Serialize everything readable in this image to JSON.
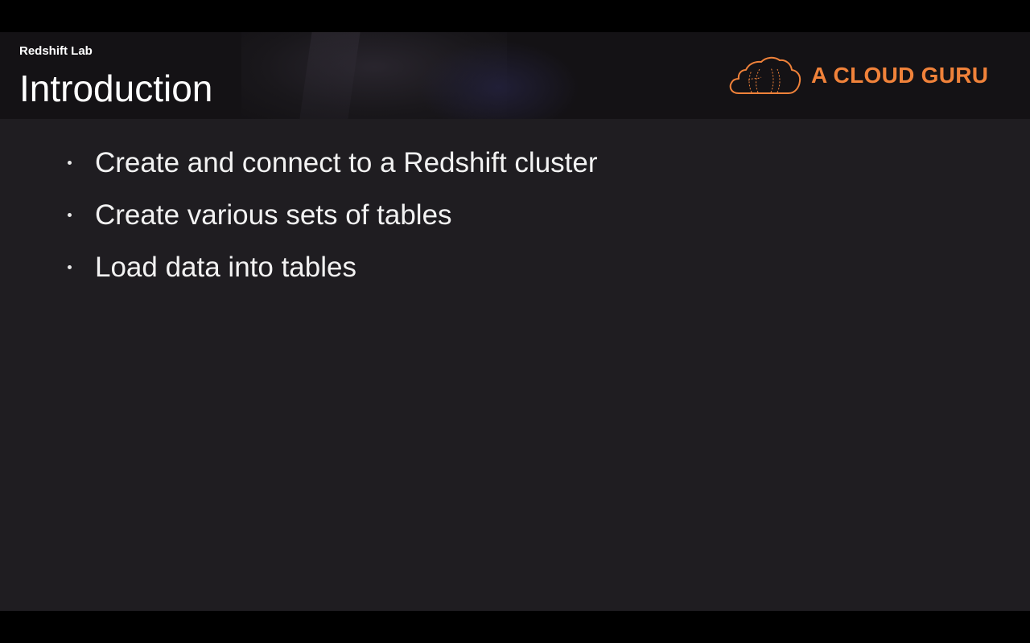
{
  "slide": {
    "section_label": "Redshift Lab",
    "title": "Introduction",
    "brand": {
      "name": "A CLOUD GURU",
      "color": "#f0823a",
      "icon": "cloud-logo-icon"
    },
    "bullets": [
      "Create and connect to a Redshift cluster",
      "Create various sets of tables",
      "Load data into tables"
    ]
  },
  "colors": {
    "slide_background": "#1f1d21",
    "header_background": "#141215",
    "letterbox": "#000000",
    "text": "#ffffff"
  }
}
